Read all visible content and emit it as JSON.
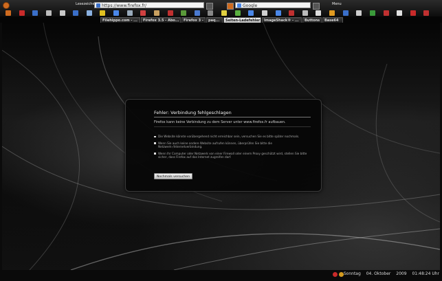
{
  "toolbar": {
    "nav_label": "Lesezeichen",
    "url": "https://www.firefox.fr/",
    "search": "Google",
    "menu_label": "Menu",
    "icons": [
      "firefox-icon",
      "feed-icon",
      "x-icon",
      "wheel-icon",
      "image-icon",
      "doc-icon",
      "photo-icon",
      "lightning-icon",
      "globe-icon",
      "picture-icon",
      "star-icon",
      "picture2-icon",
      "note-icon",
      "puzzle-icon",
      "window-icon",
      "cd-icon",
      "moon-icon",
      "leaf-icon",
      "recycle-icon",
      "bookmark-icon",
      "calendar-icon",
      "mail-icon",
      "bird-icon",
      "doc2-icon",
      "camera-icon",
      "blue-icon",
      "box-icon",
      "clover-icon",
      "music-icon",
      "alert-icon",
      "shield-icon",
      "stop-icon"
    ]
  },
  "tabs": [
    {
      "label": "Filehippo.com - ..."
    },
    {
      "label": "Firefox 3.5 - Abo..."
    },
    {
      "label": "Firefox 3 - ..."
    },
    {
      "label": "paq..."
    },
    {
      "label": "Seiten-Ladefehler"
    },
    {
      "label": "ImageShack® - ..."
    },
    {
      "label": "Buttons"
    },
    {
      "label": "Base64"
    }
  ],
  "error": {
    "title": "Fehler: Verbindung fehlgeschlagen",
    "message": "Firefox kann keine Verbindung zu dem Server unter www.firefox.fr aufbauen.",
    "items": [
      "Die Website könnte vorübergehend nicht erreichbar sein, versuchen Sie es bitte später nochmals.",
      "Wenn Sie auch keine andere Website aufrufen können, überprüfen Sie bitte die Netzwerk-/Internetverbindung.",
      "Wenn Ihr Computer oder Netzwerk von einer Firewall oder einem Proxy geschützt wird, stellen Sie bitte sicher, dass Firefox auf das Internet zugreifen darf."
    ],
    "retry_label": "Nochmals versuchen"
  },
  "status": {
    "day": "Sonntag",
    "date": "04. Oktober",
    "year": "2009",
    "time": "01:48:24 Uhr"
  },
  "colors": {
    "menu_orange": "#d06b1f",
    "active_tab": "#e0e0e0"
  }
}
